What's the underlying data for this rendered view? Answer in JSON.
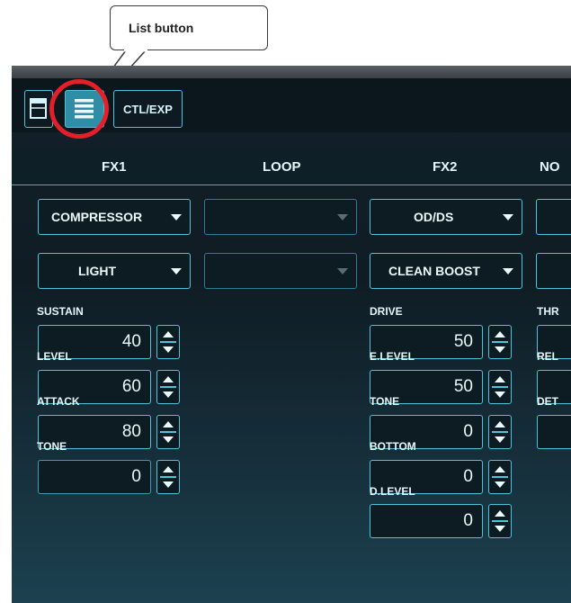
{
  "callout": {
    "text": "List button"
  },
  "toolbar": {
    "grid_icon": "grid-view-icon",
    "list_icon": "list-icon",
    "ctl_label": "CTL/EXP"
  },
  "columns": [
    "FX1",
    "LOOP",
    "FX2",
    "NO"
  ],
  "fx1": {
    "type": "COMPRESSOR",
    "mode": "LIGHT",
    "params": [
      {
        "label": "SUSTAIN",
        "value": "40"
      },
      {
        "label": "LEVEL",
        "value": "60"
      },
      {
        "label": "ATTACK",
        "value": "80"
      },
      {
        "label": "TONE",
        "value": "0"
      }
    ]
  },
  "loop": {
    "type": "",
    "mode": ""
  },
  "fx2": {
    "type": "OD/DS",
    "mode": "CLEAN BOOST",
    "params": [
      {
        "label": "DRIVE",
        "value": "50"
      },
      {
        "label": "E.LEVEL",
        "value": "50"
      },
      {
        "label": "TONE",
        "value": "0"
      },
      {
        "label": "BOTTOM",
        "value": "0"
      },
      {
        "label": "D.LEVEL",
        "value": "0"
      }
    ]
  },
  "ns": {
    "params": [
      "THR",
      "REL",
      "DET"
    ]
  },
  "colors": {
    "accent": "#4ec4dc",
    "highlight": "#e3202a",
    "background": "#0f1c24"
  }
}
